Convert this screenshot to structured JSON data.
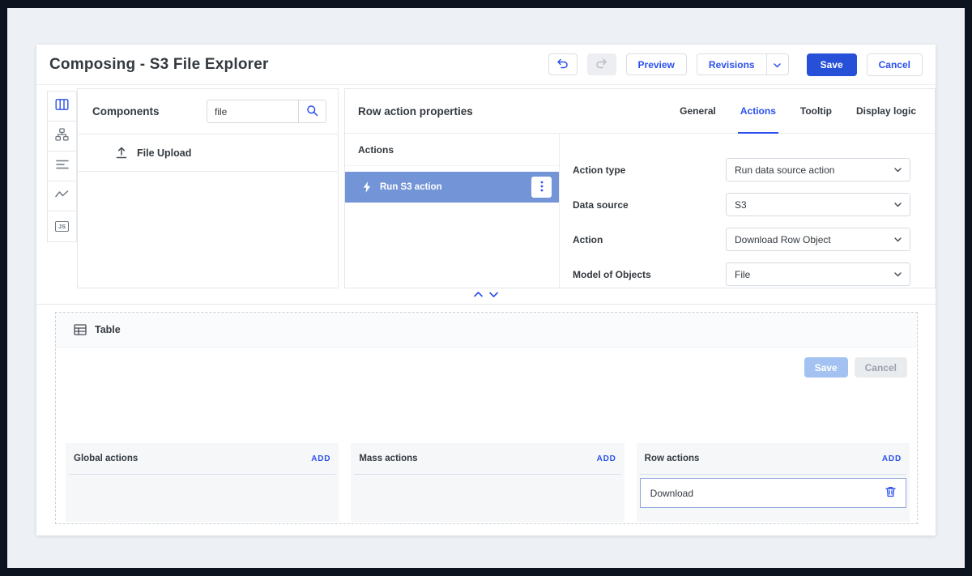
{
  "colors": {
    "accent_blue": "#2b50ed",
    "save_button_bg": "#2750d8",
    "selected_action_bg": "#7394d6",
    "page_frame": "#0d1420",
    "workspace_bg": "#edf0f4"
  },
  "header": {
    "title": "Composing - S3 File Explorer",
    "buttons": {
      "preview": "Preview",
      "revisions": "Revisions",
      "save": "Save",
      "cancel": "Cancel"
    }
  },
  "component_rail": {
    "js_label": "JS"
  },
  "components_panel": {
    "title": "Components",
    "search_value": "file",
    "items": [
      {
        "label": "File Upload"
      }
    ]
  },
  "properties_panel": {
    "title": "Row action properties",
    "tabs": [
      {
        "label": "General"
      },
      {
        "label": "Actions"
      },
      {
        "label": "Tooltip"
      },
      {
        "label": "Display logic"
      }
    ],
    "active_tab": "Actions",
    "actions_list": {
      "title": "Actions",
      "selected_item": "Run S3 action"
    },
    "fields": [
      {
        "label": "Action type",
        "value": "Run data source action"
      },
      {
        "label": "Data source",
        "value": "S3"
      },
      {
        "label": "Action",
        "value": "Download Row Object"
      },
      {
        "label": "Model of Objects",
        "value": "File"
      }
    ]
  },
  "canvas": {
    "component_label": "Table",
    "save_button": "Save",
    "cancel_button": "Cancel",
    "action_groups": [
      {
        "title": "Global actions",
        "add_label": "ADD",
        "items": []
      },
      {
        "title": "Mass actions",
        "add_label": "ADD",
        "items": []
      },
      {
        "title": "Row actions",
        "add_label": "ADD",
        "items": [
          {
            "label": "Download"
          }
        ]
      }
    ]
  }
}
